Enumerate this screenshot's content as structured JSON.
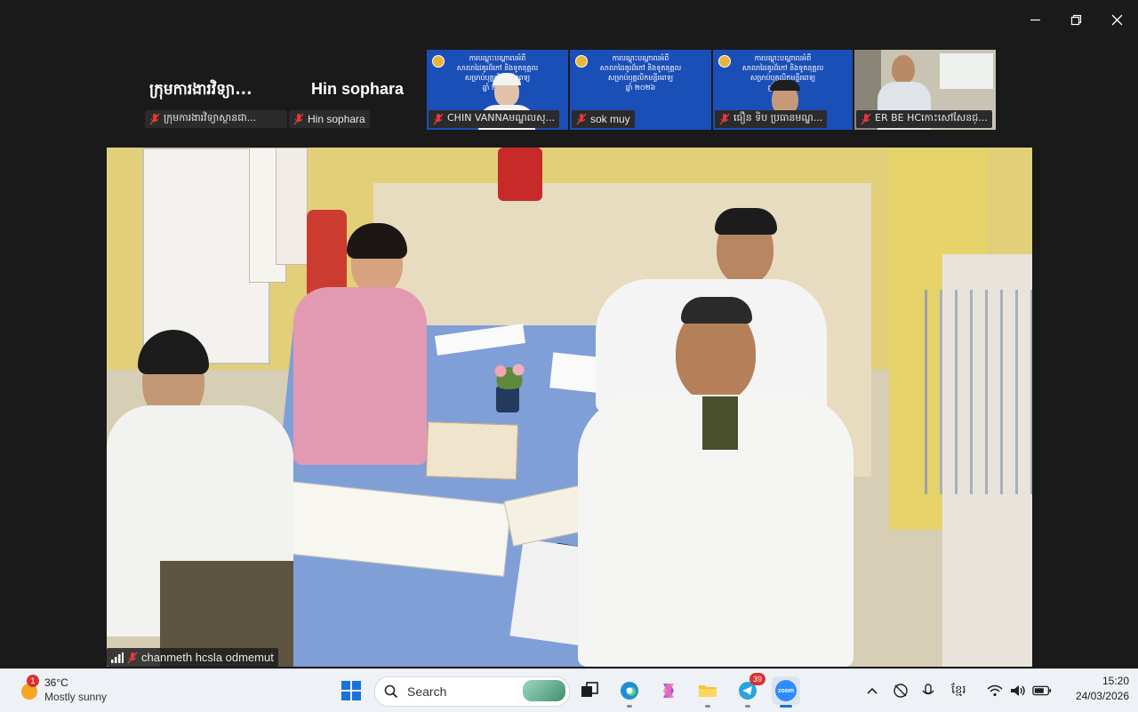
{
  "window": {
    "controls": [
      "minimize-icon",
      "restore-icon",
      "close-icon"
    ]
  },
  "gallery": {
    "tiles": [
      {
        "big_name": "ក្រុមការងារវិទ្យា...",
        "label": "ក្រុមការងារវិទ្យាស្ថានជា..."
      },
      {
        "big_name": "Hin sophara",
        "label": "Hin sophara"
      }
    ],
    "thumbnails": [
      {
        "label": "CHIN VANNAមណ្ឌលសុ...",
        "banner": "ការបណ្តុះបណ្តាលអំពី\nសាលាដៃគូរដ៏កៅ និងទូតនុគ្គល\nសម្រាប់បុគ្គលិកមន្ទីរពេទ្យ\nឆ្នាំ ២០២៦"
      },
      {
        "label": "sok muy",
        "banner": "ការបណ្តុះបណ្តាលអំពី\nសាលាដៃគូរដ៏កៅ និងទូតនុគ្គល\nសម្រាប់បុគ្គលិកមន្ទីរពេទ្យ\nឆ្នាំ ២០២៦"
      },
      {
        "label": "ធឿន ទិប ប្រធានមណ្ឌ...",
        "banner": "ការបណ្តុះបណ្តាលអំពី\nសាលាដៃគូរដ៏កៅ និងទូតនុគ្គល\nសម្រាប់បុគ្គលិកមន្ទីរពេទ្យ\nឆ្នាំ ២០២៦"
      },
      {
        "label": "ER BE HCកោះសៅសែនជ្..."
      }
    ]
  },
  "main_video": {
    "name_label": "chanmeth hcsla odmemut"
  },
  "taskbar": {
    "weather_temp": "36°C",
    "weather_desc": "Mostly sunny",
    "weather_badge": "1",
    "search_placeholder": "Search",
    "telegram_badge": "39",
    "zoom_label": "zoom",
    "language": "ខ្មែរ",
    "time": "15:20",
    "date": "24/03/2026"
  }
}
